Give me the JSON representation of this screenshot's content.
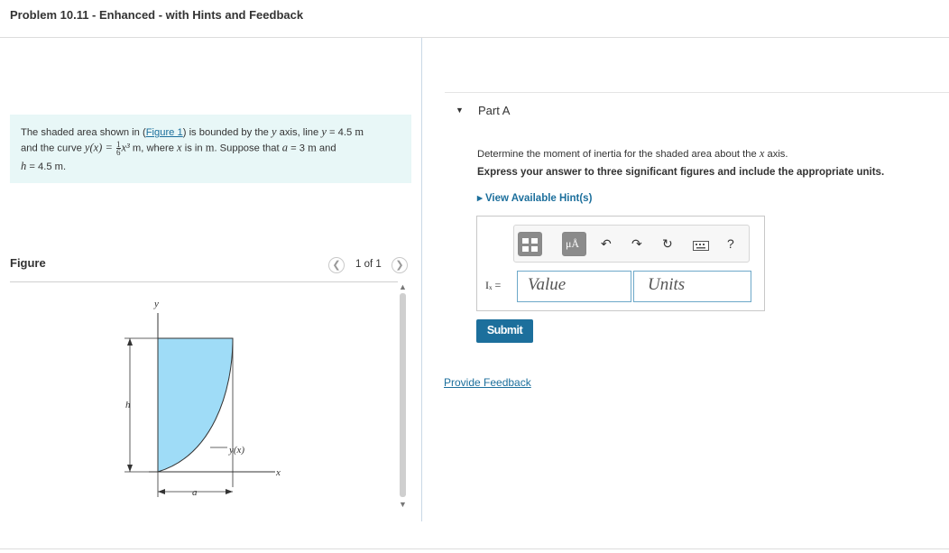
{
  "header": {
    "title": "Problem 10.11 - Enhanced - with Hints and Feedback"
  },
  "problem": {
    "line1_a": "The shaded area shown in (",
    "figure_link": "Figure 1",
    "line1_b": ") is bounded by the ",
    "y_var": "y",
    "line1_c": " axis, line ",
    "line1_eq": "y",
    "line1_d": " = 4.5 ",
    "unit_m": "m",
    "line2_a": "and the curve ",
    "curve_lhs": "y(x) =",
    "frac_num": "1",
    "frac_den": "6",
    "curve_rhs": "x³",
    "line2_b": " m, where ",
    "x_var": "x",
    "line2_c": " is in ",
    "line2_d": ". Suppose that ",
    "a_var": "a",
    "line2_e": " = 3 ",
    "line2_f": " and",
    "h_var": "h",
    "line3": " = 4.5 m."
  },
  "figure": {
    "label": "Figure",
    "pager": "1 of 1",
    "labels": {
      "y": "y",
      "h": "h",
      "yx": "y(x)",
      "x": "x",
      "a": "a"
    },
    "colors": {
      "shade": "#9fdcf7",
      "outline": "#333333"
    }
  },
  "partA": {
    "title": "Part A",
    "question_a": "Determine the moment of inertia for the shaded area about the ",
    "question_var": "x",
    "question_b": " axis.",
    "instruction": "Express your answer to three significant figures and include the appropriate units.",
    "hint_link": "View Available Hint(s)",
    "answer_label": "Iₓ =",
    "value_placeholder": "Value",
    "units_placeholder": "Units",
    "toolbar": {
      "mu": "μÅ",
      "help": "?"
    },
    "submit": "Submit"
  },
  "footer": {
    "feedback_link": "Provide Feedback"
  },
  "colors": {
    "link": "#1c6f9c",
    "problem_bg": "#e8f7f7",
    "submit_bg": "#1c6f9c"
  }
}
